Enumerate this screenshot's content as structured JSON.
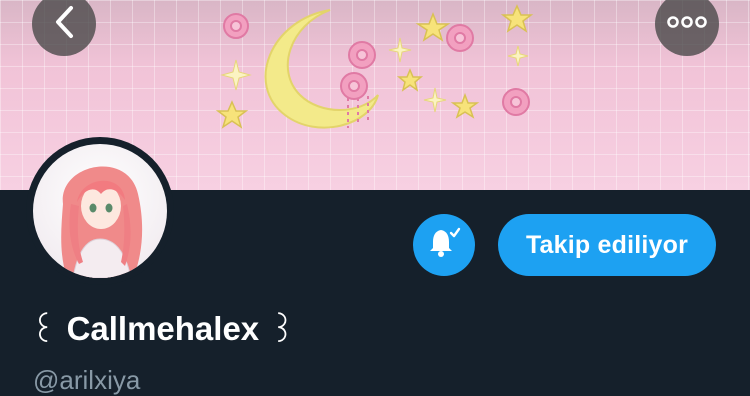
{
  "header": {
    "back_icon": "chevron-left-icon",
    "more_icon": "more-horizontal-icon"
  },
  "banner": {
    "description_icons": [
      "crescent-moon-icon",
      "star-icon",
      "rose-icon"
    ],
    "colors": {
      "background": "#f7cfe0",
      "moon": "#f3ea8a",
      "rose": "#f2a0c0",
      "star": "#f7e37a"
    }
  },
  "profile": {
    "display_name": "Callmehalex",
    "name_deco_left": "꒰",
    "name_deco_right": "꒱",
    "handle": "@arilxiya",
    "avatar_icon": "avatar-anime-girl"
  },
  "actions": {
    "notifications_icon": "bell-check-icon",
    "follow_label": "Takip ediliyor"
  },
  "colors": {
    "page_bg": "#15202b",
    "accent": "#1da1f2",
    "handle_text": "#8899a6",
    "text": "#ffffff"
  }
}
